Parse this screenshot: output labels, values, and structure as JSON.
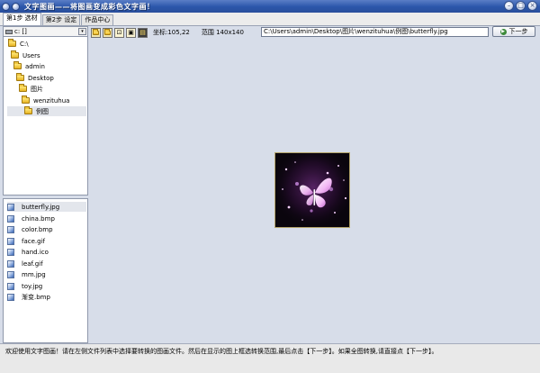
{
  "window": {
    "title": "文字图画——将图画变成彩色文字画！",
    "buttons": {
      "minimize": "–",
      "restore": "□",
      "close": "×"
    }
  },
  "tabs": [
    {
      "label": "第1步 选材",
      "active": true
    },
    {
      "label": "第2步 设定",
      "active": false
    },
    {
      "label": "作品中心",
      "active": false
    }
  ],
  "drive": {
    "label": "c: []",
    "dropdown": "▾"
  },
  "tree": [
    {
      "label": "C:\\",
      "level": 0,
      "selected": false
    },
    {
      "label": "Users",
      "level": 1,
      "selected": false
    },
    {
      "label": "admin",
      "level": 2,
      "selected": false
    },
    {
      "label": "Desktop",
      "level": 3,
      "selected": false
    },
    {
      "label": "图片",
      "level": 4,
      "selected": false
    },
    {
      "label": "wenzituhua",
      "level": 5,
      "selected": false
    },
    {
      "label": "例图",
      "level": 6,
      "selected": true
    }
  ],
  "files": [
    {
      "name": "butterfly.jpg",
      "selected": true
    },
    {
      "name": "china.bmp",
      "selected": false
    },
    {
      "name": "color.bmp",
      "selected": false
    },
    {
      "name": "face.gif",
      "selected": false
    },
    {
      "name": "hand.ico",
      "selected": false
    },
    {
      "name": "leaf.gif",
      "selected": false
    },
    {
      "name": "mm.jpg",
      "selected": false
    },
    {
      "name": "toy.jpg",
      "selected": false
    },
    {
      "name": "渐变.bmp",
      "selected": false
    }
  ],
  "toolbar": {
    "coord_label": "坐标:105,22",
    "range_label": "范围 140x140",
    "path": "C:\\Users\\admin\\Desktop\\图片\\wenzituhua\\例图\\butterfly.jpg",
    "next_label": "下一步",
    "icons": [
      "open-folder-icon",
      "folder-icon",
      "fit-icon",
      "image-icon",
      "crop-icon"
    ]
  },
  "status": {
    "message": "欢迎使用文字图画！请在左侧文件列表中选择要转换的图画文件。然后在显示的图上框选转换范围,最后点击【下一步】。如果全图转换,请直接点【下一步】。"
  },
  "colors": {
    "titlebar": "#2b56aa",
    "canvas_bg": "#d7dde9",
    "butterfly": "#f2b8f5"
  }
}
